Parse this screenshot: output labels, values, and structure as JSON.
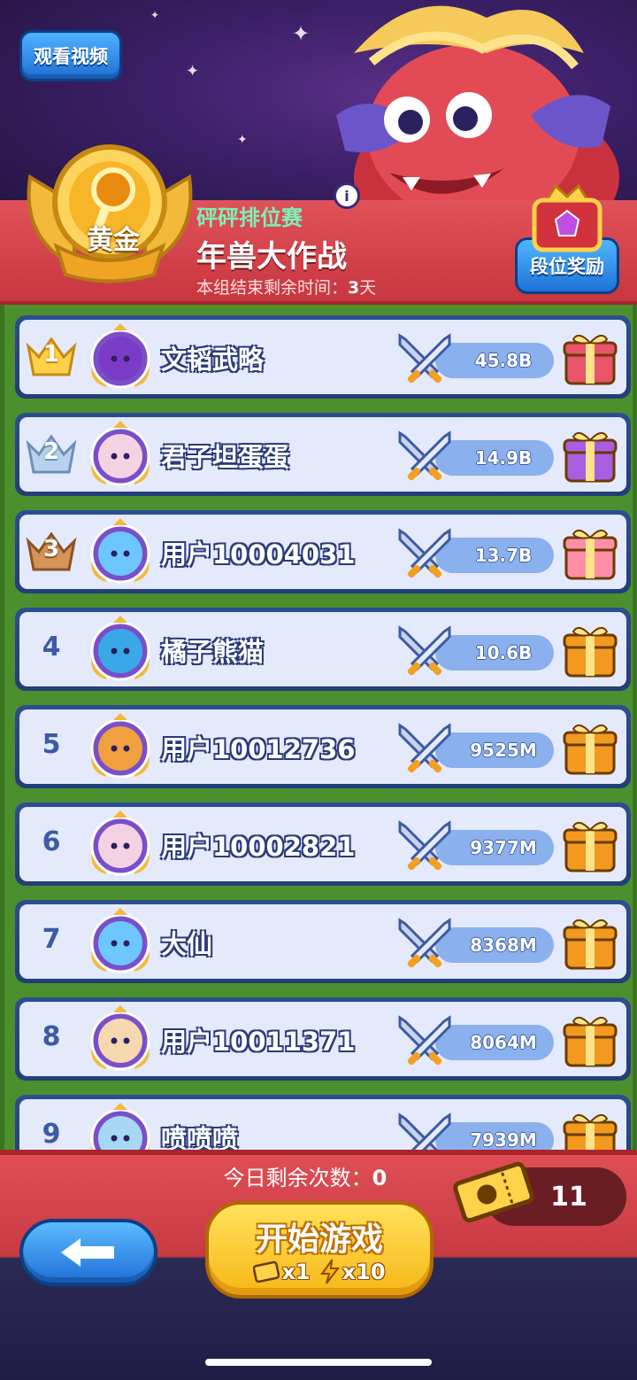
{
  "hero": {
    "watch_video_label": "观看视频"
  },
  "header": {
    "rank_tier": "黄金",
    "event_subtitle": "砰砰排位赛",
    "event_title": "年兽大作战",
    "time_remaining_prefix": "本组结束剩余时间：",
    "time_remaining_value": "3",
    "time_remaining_unit": "天",
    "rank_reward_label": "段位奖励",
    "info_icon_glyph": "i"
  },
  "leaderboard": [
    {
      "rank": "1",
      "name": "文韬武略",
      "score": "45.8B",
      "avatar_color": "#7a3cc7",
      "gift_color": "#e8546a"
    },
    {
      "rank": "2",
      "name": "君子坦蛋蛋",
      "score": "14.9B",
      "avatar_color": "#f4d2e4",
      "gift_color": "#a85ee0"
    },
    {
      "rank": "3",
      "name": "用户10004031",
      "score": "13.7B",
      "avatar_color": "#6ec6ff",
      "gift_color": "#ff8fa6"
    },
    {
      "rank": "4",
      "name": "橘子熊猫",
      "score": "10.6B",
      "avatar_color": "#3aa8e8",
      "gift_color": "#f29a20"
    },
    {
      "rank": "5",
      "name": "用户10012736",
      "score": "9525M",
      "avatar_color": "#f0a040",
      "gift_color": "#f29a20"
    },
    {
      "rank": "6",
      "name": "用户10002821",
      "score": "9377M",
      "avatar_color": "#f4d2e4",
      "gift_color": "#f29a20"
    },
    {
      "rank": "7",
      "name": "大仙",
      "score": "8368M",
      "avatar_color": "#6ec6ff",
      "gift_color": "#f29a20"
    },
    {
      "rank": "8",
      "name": "用户10011371",
      "score": "8064M",
      "avatar_color": "#f6d8b0",
      "gift_color": "#f29a20"
    },
    {
      "rank": "9",
      "name": "喷喷喷",
      "score": "7939M",
      "avatar_color": "#a6d8f4",
      "gift_color": "#f29a20"
    }
  ],
  "bottom": {
    "attempts_label": "今日剩余次数：",
    "attempts_value": "0",
    "ticket_count": "11",
    "start_label": "开始游戏",
    "ticket_cost": "x1",
    "energy_cost": "x10"
  },
  "colors": {
    "header_red": "#d0414a",
    "board_green": "#4c8f2e",
    "row_bg": "#e4e9fb",
    "row_border": "#2d4e8f",
    "start_yellow": "#f7b716",
    "button_blue": "#1d72d8",
    "event_subtitle_green": "#7ef0b6"
  }
}
